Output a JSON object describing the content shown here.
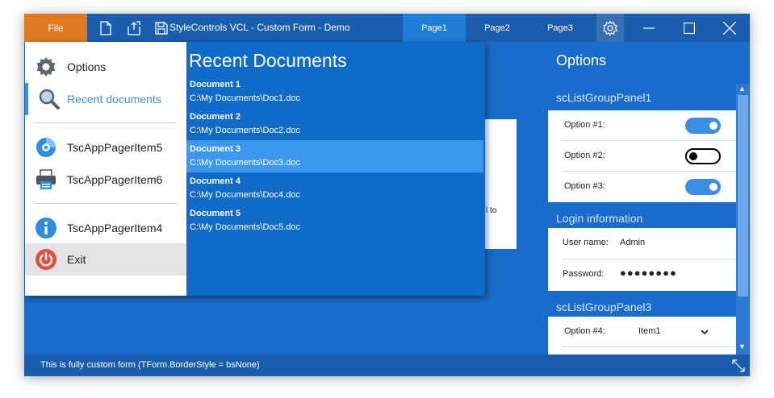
{
  "titlebar": {
    "file_label": "File",
    "title": "StyleControls VCL - Custom Form - Demo",
    "tabs": [
      {
        "label": "Page1",
        "active": true
      },
      {
        "label": "Page2",
        "active": false
      },
      {
        "label": "Page3",
        "active": false
      }
    ],
    "icons": [
      "new-document-icon",
      "export-icon",
      "save-icon",
      "gear-icon",
      "minimize-icon",
      "maximize-icon",
      "close-icon"
    ]
  },
  "content": {
    "partial_text": "l to"
  },
  "app_menu": {
    "items": [
      {
        "label": "Options",
        "icon": "gear-icon"
      },
      {
        "label": "Recent documents",
        "icon": "search-icon",
        "selected": true
      },
      {
        "label": "TscAppPagerItem5",
        "icon": "disc-icon"
      },
      {
        "label": "TscAppPagerItem6",
        "icon": "printer-icon"
      },
      {
        "label": "TscAppPagerItem4",
        "icon": "info-icon"
      },
      {
        "label": "Exit",
        "icon": "power-icon",
        "hover": true
      }
    ],
    "recent": {
      "title": "Recent Documents",
      "documents": [
        {
          "name": "Document 1",
          "path": "C:\\My Documents\\Doc1.doc"
        },
        {
          "name": "Document 2",
          "path": "C:\\My Documents\\Doc2.doc"
        },
        {
          "name": "Document 3",
          "path": "C:\\My Documents\\Doc3.doc",
          "selected": true
        },
        {
          "name": "Document 4",
          "path": "C:\\My Documents\\Doc4.doc"
        },
        {
          "name": "Document 5",
          "path": "C:\\My Documents\\Doc5.doc"
        }
      ]
    }
  },
  "options_panel": {
    "title": "Options",
    "group1": {
      "title": "scListGroupPanel1",
      "options": [
        {
          "label": "Option #1:",
          "on": true
        },
        {
          "label": "Option #2:",
          "on": false
        },
        {
          "label": "Option #3:",
          "on": true
        }
      ]
    },
    "group2": {
      "title": "Login information",
      "user_label": "User name:",
      "user_value": "Admin",
      "password_label": "Password:",
      "password_value": "●●●●●●●●"
    },
    "group3": {
      "title": "scListGroupPanel3",
      "option4_label": "Option #4:",
      "option4_value": "Item1"
    }
  },
  "statusbar": {
    "text": "This is fully custom form (TForm.BorderStyle = bsNone)"
  },
  "colors": {
    "accent": "#1a6ccc",
    "title_bar": "#1b5dad",
    "file_button": "#e07a21",
    "toggle_on": "#3a8fe4"
  }
}
